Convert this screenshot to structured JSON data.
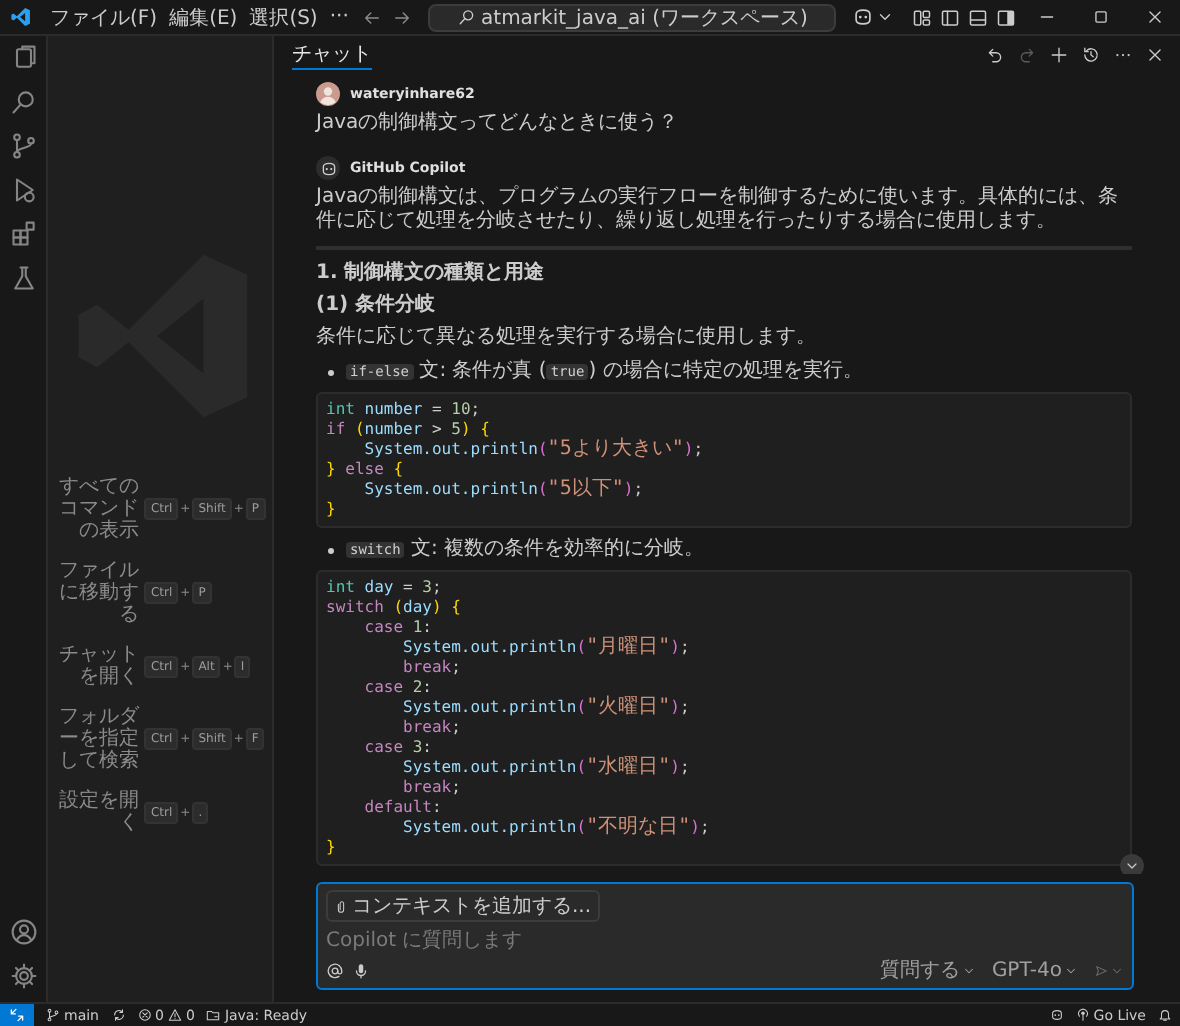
{
  "title_bar": {
    "menus": [
      "ファイル(F)",
      "編集(E)",
      "選択(S)",
      "···"
    ],
    "search": "atmarkit_java_ai (ワークスペース)"
  },
  "shortcuts": [
    {
      "label": "すべてのコマンドの表示",
      "keys": [
        "Ctrl",
        "+",
        "Shift",
        "+",
        "P"
      ]
    },
    {
      "label": "ファイルに移動する",
      "keys": [
        "Ctrl",
        "+",
        "P"
      ]
    },
    {
      "label": "チャットを開く",
      "keys": [
        "Ctrl",
        "+",
        "Alt",
        "+",
        "I"
      ]
    },
    {
      "label": "フォルダーを指定して検索",
      "keys": [
        "Ctrl",
        "+",
        "Shift",
        "+",
        "F"
      ]
    },
    {
      "label": "設定を開く",
      "keys": [
        "Ctrl",
        "+",
        "."
      ]
    }
  ],
  "chat": {
    "tab": {
      "label": "チャット",
      "selected": true
    },
    "user": {
      "author": "wateryinhare62",
      "text": "Javaの制御構文ってどんなときに使う？"
    },
    "assistant": {
      "author": "GitHub Copilot",
      "blocks": [
        {
          "kind": "paragraph",
          "text": "Javaの制御構文は、プログラムの実行フローを制御するために使います。具体的には、条件に応じて処理を分岐させたり、繰り返し処理を行ったりする場合に使用します。"
        },
        {
          "kind": "rule"
        },
        {
          "kind": "heading",
          "text": "1. 制御構文の種類と用途"
        },
        {
          "kind": "heading",
          "text": "(1) 条件分岐"
        },
        {
          "kind": "paragraph",
          "text": "条件に応じて異なる処理を実行する場合に使用します。"
        },
        {
          "kind": "bullet",
          "parts": [
            {
              "kind": "code",
              "text": "if-else"
            },
            {
              "kind": "text",
              "text": " 文: 条件が真 ("
            },
            {
              "kind": "code",
              "text": "true"
            },
            {
              "kind": "text",
              "text": ") の場合に特定の処理を実行。"
            }
          ]
        },
        {
          "kind": "code",
          "lines": [
            [
              {
                "kind": "type",
                "text": "int"
              },
              {
                "kind": "var",
                "text": " number"
              },
              {
                "kind": "plain",
                "text": " = "
              },
              {
                "kind": "num",
                "text": "10"
              },
              {
                "kind": "plain",
                "text": ";"
              }
            ],
            [
              {
                "kind": "kw",
                "text": "if"
              },
              {
                "kind": "brace",
                "text": " ("
              },
              {
                "kind": "var",
                "text": "number"
              },
              {
                "kind": "plain",
                "text": " > "
              },
              {
                "kind": "num",
                "text": "5"
              },
              {
                "kind": "brace",
                "text": ")"
              },
              {
                "kind": "brace",
                "text": " {"
              }
            ],
            [
              {
                "kind": "var",
                "text": "    System.out.println"
              },
              {
                "kind": "paren",
                "text": "("
              },
              {
                "kind": "str",
                "text": "\"5より大きい\""
              },
              {
                "kind": "paren",
                "text": ")"
              },
              {
                "kind": "plain",
                "text": ";"
              }
            ],
            [
              {
                "kind": "brace",
                "text": "}"
              },
              {
                "kind": "kw",
                "text": " else"
              },
              {
                "kind": "brace",
                "text": " {"
              }
            ],
            [
              {
                "kind": "var",
                "text": "    System.out.println"
              },
              {
                "kind": "paren",
                "text": "("
              },
              {
                "kind": "str",
                "text": "\"5以下\""
              },
              {
                "kind": "paren",
                "text": ")"
              },
              {
                "kind": "plain",
                "text": ";"
              }
            ],
            [
              {
                "kind": "brace",
                "text": "}"
              }
            ]
          ]
        },
        {
          "kind": "bullet",
          "parts": [
            {
              "kind": "code",
              "text": "switch"
            },
            {
              "kind": "text",
              "text": " 文: 複数の条件を効率的に分岐。"
            }
          ]
        },
        {
          "kind": "code",
          "lines": [
            [
              {
                "kind": "type",
                "text": "int"
              },
              {
                "kind": "var",
                "text": " day"
              },
              {
                "kind": "plain",
                "text": " = "
              },
              {
                "kind": "num",
                "text": "3"
              },
              {
                "kind": "plain",
                "text": ";"
              }
            ],
            [
              {
                "kind": "kw",
                "text": "switch"
              },
              {
                "kind": "brace",
                "text": " ("
              },
              {
                "kind": "var",
                "text": "day"
              },
              {
                "kind": "brace",
                "text": ")"
              },
              {
                "kind": "brace",
                "text": " {"
              }
            ],
            [
              {
                "kind": "kw",
                "text": "    case"
              },
              {
                "kind": "num",
                "text": " 1"
              },
              {
                "kind": "plain",
                "text": ":"
              }
            ],
            [
              {
                "kind": "var",
                "text": "        System.out.println"
              },
              {
                "kind": "paren",
                "text": "("
              },
              {
                "kind": "str",
                "text": "\"月曜日\""
              },
              {
                "kind": "paren",
                "text": ")"
              },
              {
                "kind": "plain",
                "text": ";"
              }
            ],
            [
              {
                "kind": "kw",
                "text": "        break"
              },
              {
                "kind": "plain",
                "text": ";"
              }
            ],
            [
              {
                "kind": "kw",
                "text": "    case"
              },
              {
                "kind": "num",
                "text": " 2"
              },
              {
                "kind": "plain",
                "text": ":"
              }
            ],
            [
              {
                "kind": "var",
                "text": "        System.out.println"
              },
              {
                "kind": "paren",
                "text": "("
              },
              {
                "kind": "str",
                "text": "\"火曜日\""
              },
              {
                "kind": "paren",
                "text": ")"
              },
              {
                "kind": "plain",
                "text": ";"
              }
            ],
            [
              {
                "kind": "kw",
                "text": "        break"
              },
              {
                "kind": "plain",
                "text": ";"
              }
            ],
            [
              {
                "kind": "kw",
                "text": "    case"
              },
              {
                "kind": "num",
                "text": " 3"
              },
              {
                "kind": "plain",
                "text": ":"
              }
            ],
            [
              {
                "kind": "var",
                "text": "        System.out.println"
              },
              {
                "kind": "paren",
                "text": "("
              },
              {
                "kind": "str",
                "text": "\"水曜日\""
              },
              {
                "kind": "paren",
                "text": ")"
              },
              {
                "kind": "plain",
                "text": ";"
              }
            ],
            [
              {
                "kind": "kw",
                "text": "        break"
              },
              {
                "kind": "plain",
                "text": ";"
              }
            ],
            [
              {
                "kind": "kw",
                "text": "    default"
              },
              {
                "kind": "plain",
                "text": ":"
              }
            ],
            [
              {
                "kind": "var",
                "text": "        System.out.println"
              },
              {
                "kind": "paren",
                "text": "("
              },
              {
                "kind": "str",
                "text": "\"不明な日\""
              },
              {
                "kind": "paren",
                "text": ")"
              },
              {
                "kind": "plain",
                "text": ";"
              }
            ],
            [
              {
                "kind": "brace",
                "text": "}"
              }
            ]
          ]
        }
      ]
    },
    "input": {
      "context": "コンテキストを追加する...",
      "placeholder": "Copilot に質問します",
      "mode": "質問する",
      "model": "GPT-4o"
    }
  },
  "status_bar": {
    "branch": "main",
    "errors": "0",
    "warnings": "0",
    "java": "Java: Ready",
    "go_live": "Go Live"
  }
}
